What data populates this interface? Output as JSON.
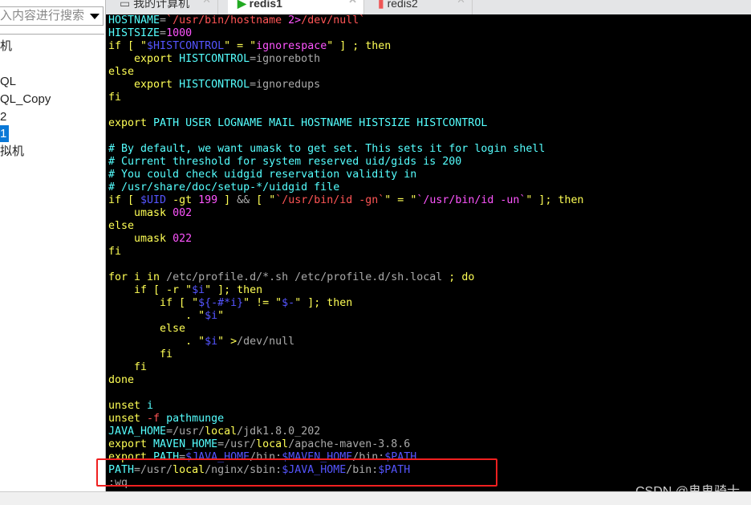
{
  "sidebar": {
    "search_placeholder": "入内容进行搜索",
    "items": [
      {
        "label": "机",
        "selected": false
      },
      {
        "label": "QL",
        "selected": false
      },
      {
        "label": "QL_Copy",
        "selected": false
      },
      {
        "label": "2",
        "selected": false
      },
      {
        "label": "1",
        "selected": true
      },
      {
        "label": "拟机",
        "selected": false
      }
    ]
  },
  "tabs": [
    {
      "label": "我的计算机",
      "active": false
    },
    {
      "label": "redis1",
      "active": true
    },
    {
      "label": "redis2",
      "active": false
    }
  ],
  "colors": {
    "y": "#ffff55",
    "c": "#55ffff",
    "r": "#ff5555",
    "m": "#ff55ff",
    "b": "#5555ff",
    "g": "#aaaaaa",
    "w": "#ffffff",
    "highlight": "#f02020"
  },
  "terminal": {
    "lines": [
      [
        [
          "HOSTNAME",
          "c"
        ],
        [
          "=",
          "g"
        ],
        [
          "`/usr/bin/hostname ",
          "r"
        ],
        [
          "2>",
          "m"
        ],
        [
          "/dev/null`",
          "r"
        ]
      ],
      [
        [
          "HISTSIZE",
          "c"
        ],
        [
          "=",
          "g"
        ],
        [
          "1000",
          "m"
        ]
      ],
      [
        [
          "if [ \"",
          "y"
        ],
        [
          "$HISTCONTROL",
          "b"
        ],
        [
          "\" = \"",
          "y"
        ],
        [
          "ignorespace",
          "m"
        ],
        [
          "\" ] ; then",
          "y"
        ]
      ],
      [
        [
          "    export ",
          "y"
        ],
        [
          "HISTCONTROL",
          "c"
        ],
        [
          "=ignoreboth",
          "g"
        ]
      ],
      [
        [
          "else",
          "y"
        ]
      ],
      [
        [
          "    export ",
          "y"
        ],
        [
          "HISTCONTROL",
          "c"
        ],
        [
          "=ignoredups",
          "g"
        ]
      ],
      [
        [
          "fi",
          "y"
        ]
      ],
      [],
      [
        [
          "export ",
          "y"
        ],
        [
          "PATH USER LOGNAME MAIL HOSTNAME HISTSIZE HISTCONTROL",
          "c"
        ]
      ],
      [],
      [
        [
          "# By default, we want umask to get set. This sets it for login shell",
          "c"
        ]
      ],
      [
        [
          "# Current threshold for system reserved uid/gids is 200",
          "c"
        ]
      ],
      [
        [
          "# You could check uidgid reservation validity in",
          "c"
        ]
      ],
      [
        [
          "# /usr/share/doc/setup-*/uidgid file",
          "c"
        ]
      ],
      [
        [
          "if [ ",
          "y"
        ],
        [
          "$UID",
          "b"
        ],
        [
          " -gt ",
          "y"
        ],
        [
          "199",
          "m"
        ],
        [
          " ] ",
          "y"
        ],
        [
          "&&",
          "g"
        ],
        [
          " [ \"",
          "y"
        ],
        [
          "`/usr/bin/id -gn`",
          "r"
        ],
        [
          "\" = \"",
          "y"
        ],
        [
          "`/usr/bin/id -un`",
          "m"
        ],
        [
          "\" ]; then",
          "y"
        ]
      ],
      [
        [
          "    umask ",
          "y"
        ],
        [
          "002",
          "m"
        ]
      ],
      [
        [
          "else",
          "y"
        ]
      ],
      [
        [
          "    umask ",
          "y"
        ],
        [
          "022",
          "m"
        ]
      ],
      [
        [
          "fi",
          "y"
        ]
      ],
      [],
      [
        [
          "for i in ",
          "y"
        ],
        [
          "/etc/profile.d/*.sh /etc/profile.d/sh.local",
          "g"
        ],
        [
          " ; do",
          "y"
        ]
      ],
      [
        [
          "    if [ -r \"",
          "y"
        ],
        [
          "$i",
          "b"
        ],
        [
          "\" ]; then",
          "y"
        ]
      ],
      [
        [
          "        if [ \"",
          "y"
        ],
        [
          "${-#*i}",
          "b"
        ],
        [
          "\" != \"",
          "y"
        ],
        [
          "$-",
          "b"
        ],
        [
          "\" ]; then",
          "y"
        ]
      ],
      [
        [
          "            . \"",
          "y"
        ],
        [
          "$i",
          "b"
        ],
        [
          "\"",
          "y"
        ]
      ],
      [
        [
          "        else",
          "y"
        ]
      ],
      [
        [
          "            . \"",
          "y"
        ],
        [
          "$i",
          "b"
        ],
        [
          "\" >",
          "y"
        ],
        [
          "/dev/null",
          "g"
        ]
      ],
      [
        [
          "        fi",
          "y"
        ]
      ],
      [
        [
          "    fi",
          "y"
        ]
      ],
      [
        [
          "done",
          "y"
        ]
      ],
      [],
      [
        [
          "unset ",
          "y"
        ],
        [
          "i",
          "c"
        ]
      ],
      [
        [
          "unset ",
          "y"
        ],
        [
          "-f",
          "r"
        ],
        [
          " pathmunge",
          "c"
        ]
      ],
      [
        [
          "JAVA_HOME",
          "c"
        ],
        [
          "=/usr/",
          "g"
        ],
        [
          "local",
          "y"
        ],
        [
          "/jdk1.8.0_202",
          "g"
        ]
      ],
      [
        [
          "export ",
          "y"
        ],
        [
          "MAVEN_HOME",
          "c"
        ],
        [
          "=/usr/",
          "g"
        ],
        [
          "local",
          "y"
        ],
        [
          "/apache-maven-3.8.6",
          "g"
        ]
      ],
      [
        [
          "export ",
          "y"
        ],
        [
          "PATH",
          "c"
        ],
        [
          "=",
          "g"
        ],
        [
          "$JAVA_HOME",
          "b"
        ],
        [
          "/bin:",
          "g"
        ],
        [
          "$MAVEN_HOME",
          "b"
        ],
        [
          "/bin:",
          "g"
        ],
        [
          "$PATH",
          "b"
        ]
      ],
      [
        [
          "PATH",
          "c"
        ],
        [
          "=/usr/",
          "g"
        ],
        [
          "local",
          "y"
        ],
        [
          "/nginx/sbin:",
          "g"
        ],
        [
          "$JAVA_HOME",
          "b"
        ],
        [
          "/bin:",
          "g"
        ],
        [
          "$PATH",
          "b"
        ]
      ],
      [
        [
          ":wq",
          "g"
        ]
      ]
    ]
  },
  "watermark": "CSDN @鬼鬼骑士"
}
